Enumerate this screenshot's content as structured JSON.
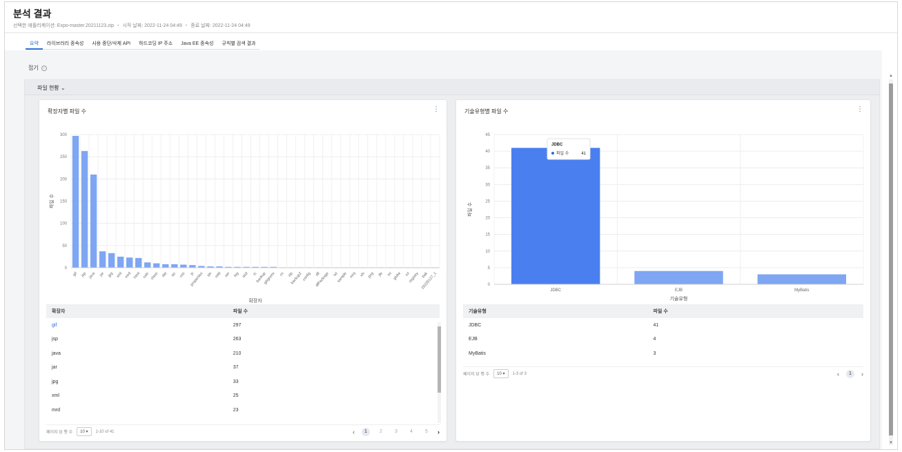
{
  "header": {
    "title": "분석 결과",
    "selected_app": "선택한 애플리케이션: Expo-master.20211123.zip",
    "start_date": "시작 날짜: 2022-11-24 04:49",
    "end_date": "종료 날짜: 2022-11-24 04:49"
  },
  "tabs": [
    {
      "label": "요약",
      "active": true
    },
    {
      "label": "라이브러리 종속성",
      "active": false
    },
    {
      "label": "사용 중단/삭제 API",
      "active": false
    },
    {
      "label": "하드코딩 IP 주소",
      "active": false
    },
    {
      "label": "Java EE 종속성",
      "active": false
    },
    {
      "label": "규칙별 검색 결과",
      "active": false
    }
  ],
  "collapse_label": "접기",
  "section_label": "파일 현황",
  "left_card": {
    "title": "확장자별 파일 수",
    "table_headers": [
      "확장자",
      "파일 수"
    ],
    "rows": [
      {
        "ext": "gif",
        "count": "297"
      },
      {
        "ext": "jsp",
        "count": "263"
      },
      {
        "ext": "java",
        "count": "210"
      },
      {
        "ext": "jar",
        "count": "37"
      },
      {
        "ext": "jpg",
        "count": "33"
      },
      {
        "ext": "xml",
        "count": "25"
      },
      {
        "ext": "mrd",
        "count": "23"
      }
    ],
    "rows_per_page_label": "페이지 당 행 수",
    "rows_per_page": "10",
    "range": "1-10 of 41",
    "pages": [
      "1",
      "2",
      "3",
      "4",
      "5"
    ]
  },
  "right_card": {
    "title": "기술유형별 파일 수",
    "tooltip": {
      "title": "JDBC",
      "series": "파일 수",
      "value": "41"
    },
    "table_headers": [
      "기술유형",
      "파일 수"
    ],
    "rows": [
      {
        "type": "JDBC",
        "count": "41"
      },
      {
        "type": "EJB",
        "count": "4"
      },
      {
        "type": "MyBatis",
        "count": "3"
      }
    ],
    "rows_per_page_label": "페이지 당 행 수",
    "rows_per_page": "10",
    "range": "1-3 of 3",
    "pages": [
      "1"
    ]
  },
  "colors": {
    "accent": "#2b6cd6",
    "bar": "#7ea6f2",
    "bar_highlight": "#4a7ff0"
  },
  "chart_data": [
    {
      "type": "bar",
      "title": "확장자별 파일 수",
      "xlabel": "확장자",
      "ylabel": "파일 수",
      "ylim": [
        0,
        300
      ],
      "yticks": [
        0,
        50,
        100,
        150,
        200,
        250,
        300
      ],
      "grid": true,
      "categories": [
        "gif",
        "jsp",
        "java",
        "jar",
        "jpg",
        "xml",
        "mrd",
        "html",
        "calc",
        "class",
        "dat",
        "sic",
        "css",
        "js",
        "properties",
        "sln",
        "mfd",
        "ser",
        "log",
        "asd",
        "tc",
        "backup",
        "gitignore",
        "cs",
        "zip",
        "backup2",
        "config",
        "dll",
        "dfPackage",
        "txt",
        "sample",
        "mrq",
        "xls",
        "png",
        "jfe",
        "ini",
        "gitdw",
        "ict",
        "registry",
        "bak",
        "20220127_1"
      ],
      "values": [
        297,
        263,
        210,
        37,
        33,
        25,
        23,
        22,
        12,
        10,
        8,
        8,
        7,
        6,
        4,
        3,
        3,
        2,
        2,
        2,
        2,
        2,
        2,
        1,
        1,
        1,
        1,
        1,
        1,
        1,
        1,
        1,
        1,
        1,
        1,
        1,
        1,
        1,
        1,
        1,
        1
      ]
    },
    {
      "type": "bar",
      "title": "기술유형별 파일 수",
      "xlabel": "기술유형",
      "ylabel": "파일 수",
      "ylim": [
        0,
        45
      ],
      "yticks": [
        0,
        5,
        10,
        15,
        20,
        25,
        30,
        35,
        40,
        45
      ],
      "grid": true,
      "categories": [
        "JDBC",
        "EJB",
        "MyBatis"
      ],
      "values": [
        41,
        4,
        3
      ]
    }
  ]
}
